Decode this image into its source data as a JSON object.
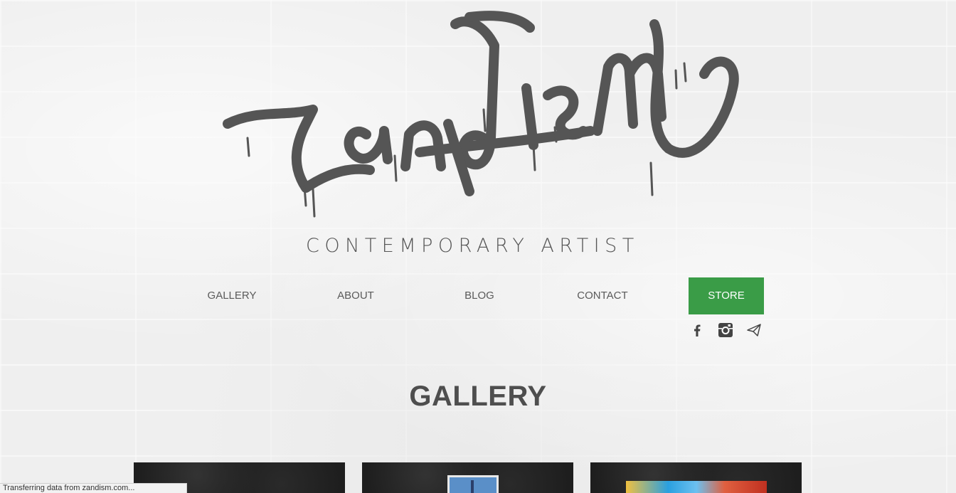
{
  "brand": {
    "logo_text": "zandism",
    "tagline": "CONTEMPORARY ARTIST"
  },
  "nav": {
    "items": [
      {
        "label": "GALLERY"
      },
      {
        "label": "ABOUT"
      },
      {
        "label": "BLOG"
      },
      {
        "label": "CONTACT"
      }
    ],
    "store_label": "STORE",
    "store_color": "#3a9c47"
  },
  "social": {
    "icons": [
      "facebook-icon",
      "instagram-icon",
      "paper-plane-icon"
    ]
  },
  "main": {
    "heading": "GALLERY"
  },
  "status_bar": {
    "text": "Transferring data from zandism.com..."
  }
}
